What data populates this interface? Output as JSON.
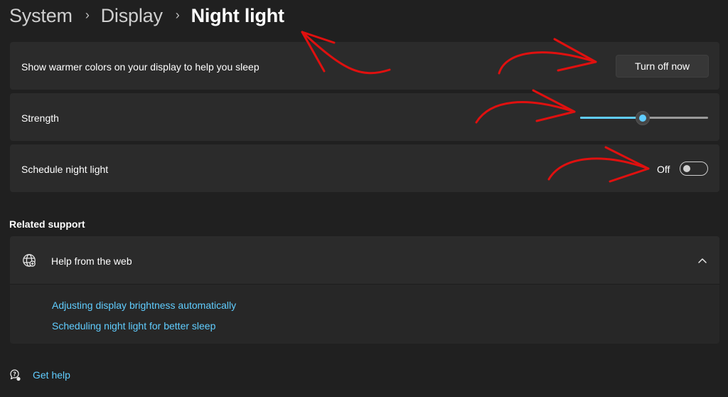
{
  "breadcrumb": {
    "items": [
      "System",
      "Display"
    ],
    "current": "Night light",
    "separator": "›"
  },
  "night_light": {
    "description": "Show warmer colors on your display to help you sleep",
    "button_label": "Turn off now"
  },
  "strength": {
    "label": "Strength",
    "value_fraction": 0.49
  },
  "schedule": {
    "label": "Schedule night light",
    "state_label": "Off",
    "enabled": false
  },
  "related_support": {
    "title": "Related support",
    "expander_title": "Help from the web",
    "links": [
      "Adjusting display brightness automatically",
      "Scheduling night light for better sleep"
    ]
  },
  "footer": {
    "get_help_label": "Get help"
  },
  "icons": {
    "breadcrumb_separator": "chevron-right-icon",
    "globe": "globe-icon",
    "expander_toggle": "chevron-up-icon",
    "get_help": "help-chat-icon"
  },
  "colors": {
    "background": "#202020",
    "card": "#2b2b2b",
    "accent": "#60cdff",
    "annotation_arrow": "#e0100f"
  }
}
